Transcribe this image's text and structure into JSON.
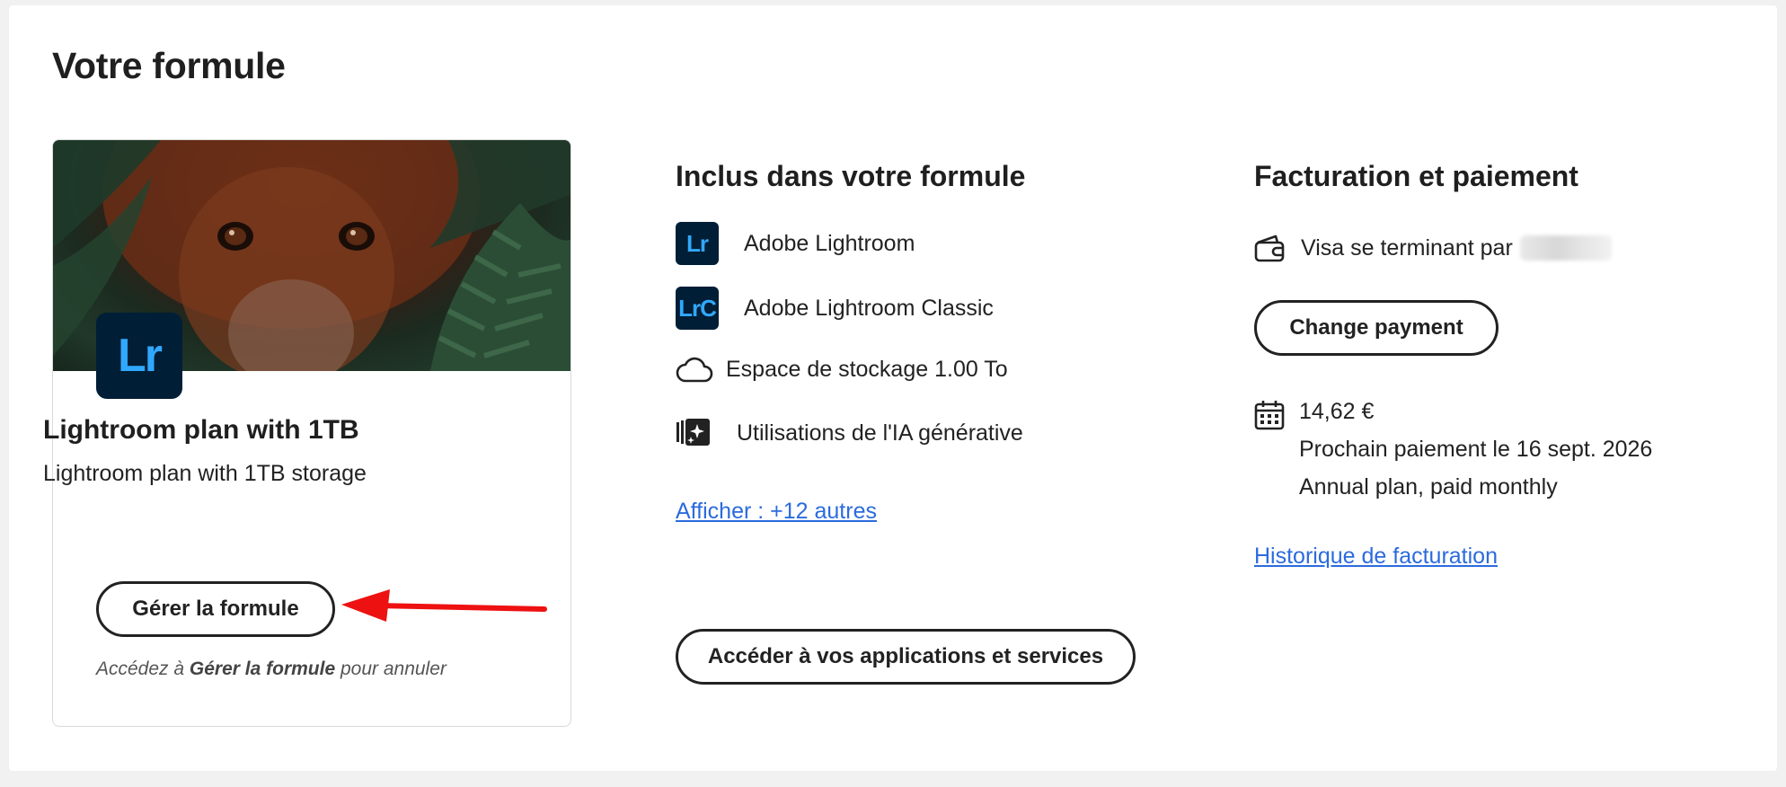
{
  "page": {
    "title": "Votre formule"
  },
  "plan_card": {
    "app_badge": "Lr",
    "plan_name": "Lightroom plan with 1TB",
    "plan_description": "Lightroom plan with 1TB storage",
    "manage_button": "Gérer la formule",
    "cancel_note_prefix": "Accédez à ",
    "cancel_note_bold": "Gérer la formule",
    "cancel_note_suffix": " pour annuler"
  },
  "included": {
    "heading": "Inclus dans votre formule",
    "items": [
      {
        "badge": "Lr",
        "label": "Adobe Lightroom",
        "icon": "lightroom-icon"
      },
      {
        "badge": "LrC",
        "label": "Adobe Lightroom Classic",
        "icon": "lightroom-classic-icon"
      },
      {
        "label": "Espace de stockage 1.00 To",
        "icon": "cloud-icon"
      },
      {
        "label": "Utilisations de l'IA générative",
        "icon": "generative-ai-icon"
      }
    ],
    "show_more_link": "Afficher : +12 autres",
    "apps_button": "Accéder à vos applications et services"
  },
  "billing": {
    "heading": "Facturation et paiement",
    "payment_method": "Visa se terminant par",
    "change_payment_button": "Change payment",
    "amount": "14,62 €",
    "next_payment": "Prochain paiement le 16 sept. 2026",
    "plan_type": "Annual plan, paid monthly",
    "history_link": "Historique de facturation"
  },
  "colors": {
    "link": "#2b6bde",
    "lightroom_bg": "#001e36",
    "lightroom_fg": "#31a8ff",
    "annotation_arrow": "#ee1111"
  }
}
